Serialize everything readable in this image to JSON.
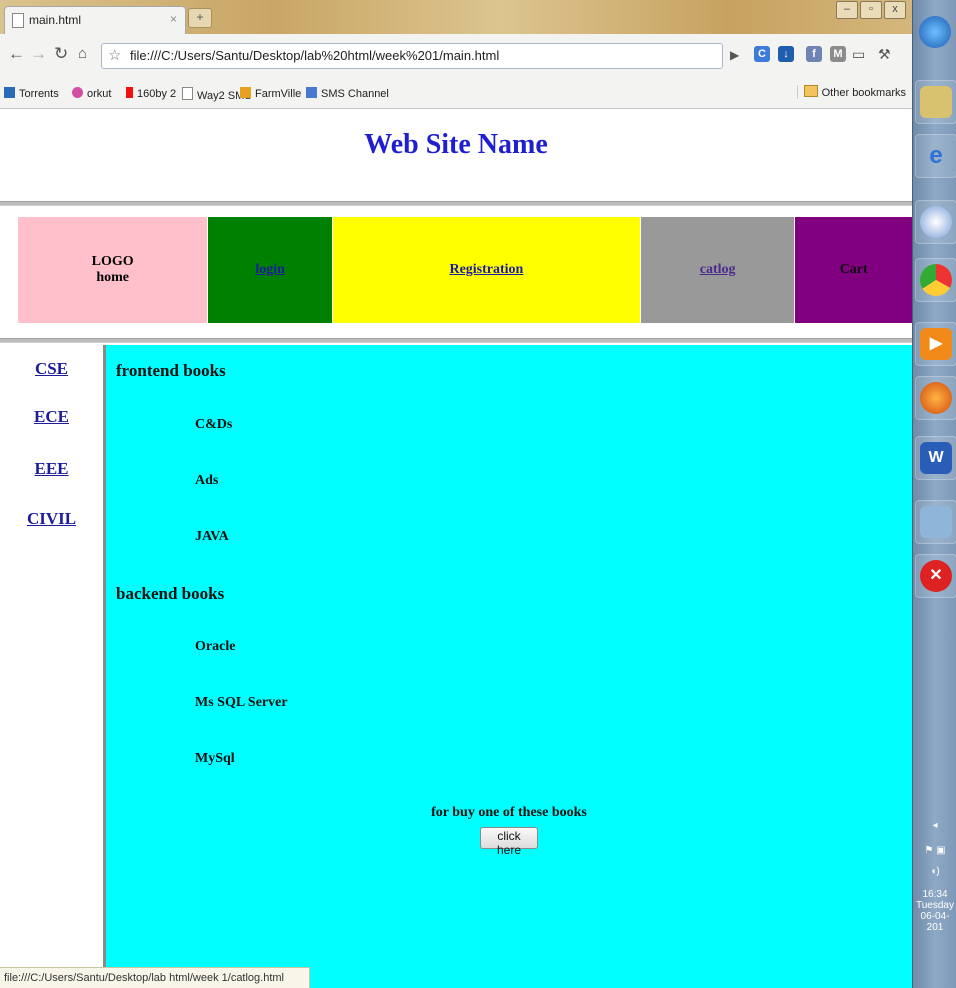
{
  "browser": {
    "tab_title": "main.html",
    "url": "file:///C:/Users/Santu/Desktop/lab%20html/week%201/main.html",
    "bookmarks": [
      "Torrents",
      "orkut",
      "160by 2",
      "Way2 SMS",
      "FarmVille",
      "SMS Channel"
    ],
    "other_bookmarks": "Other bookmarks",
    "status_url": "file:///C:/Users/Santu/Desktop/lab html/week 1/catlog.html"
  },
  "page": {
    "site_title": "Web Site Name",
    "nav": {
      "logo_line1": "LOGO",
      "logo_line2": "home",
      "login": "login",
      "registration": "Registration",
      "catlog": "catlog",
      "cart": "Cart"
    },
    "nav_colors": {
      "logo": "#ffc0cb",
      "login": "#008000",
      "registration": "#ffff00",
      "catlog": "#999999",
      "cart": "#800080"
    },
    "sidebar": [
      "CSE",
      "ECE",
      "EEE",
      "CIVIL"
    ],
    "frontend_heading": "frontend books",
    "frontend_books": [
      "C&Ds",
      "Ads",
      "JAVA"
    ],
    "backend_heading": "backend books",
    "backend_books": [
      "Oracle",
      "Ms SQL Server",
      "MySql"
    ],
    "buy_text": "for buy one of these books",
    "buy_button": "click here",
    "content_bg": "#00ffff"
  },
  "taskbar": {
    "time": "16:34",
    "day": "Tuesday",
    "date": "06-04-201"
  }
}
